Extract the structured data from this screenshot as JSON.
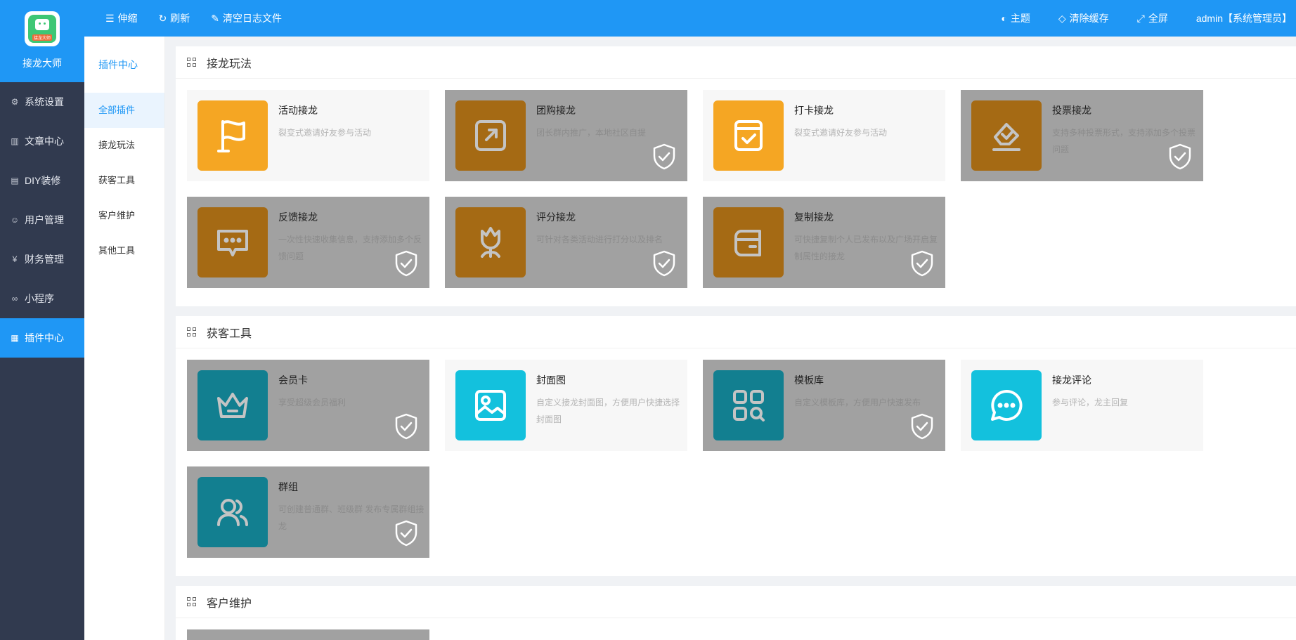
{
  "brand": {
    "logo_tag": "接龙大师",
    "name": "接龙大师"
  },
  "sidebar": {
    "items": [
      {
        "label": "系统设置",
        "icon": "gear-icon"
      },
      {
        "label": "文章中心",
        "icon": "book-icon"
      },
      {
        "label": "DIY装修",
        "icon": "layout-icon"
      },
      {
        "label": "用户管理",
        "icon": "user-icon"
      },
      {
        "label": "财务管理",
        "icon": "yen-icon"
      },
      {
        "label": "小程序",
        "icon": "link-icon"
      },
      {
        "label": "插件中心",
        "icon": "apps-icon"
      }
    ],
    "active": "插件中心"
  },
  "topbar": {
    "collapse": "伸缩",
    "refresh": "刷新",
    "clear_logs": "清空日志文件",
    "theme": "主题",
    "clear_cache": "清除缓存",
    "fullscreen": "全屏",
    "user": "admin【系统管理员】"
  },
  "submenu": {
    "title": "插件中心",
    "items": [
      "全部插件",
      "接龙玩法",
      "获客工具",
      "客户维护",
      "其他工具"
    ],
    "active": "全部插件"
  },
  "sections": [
    {
      "title": "接龙玩法",
      "cards": [
        {
          "name": "活动接龙",
          "desc": "裂变式邀请好友参与活动"
        },
        {
          "name": "团购接龙",
          "desc": "团长群内推广，本地社区自提"
        },
        {
          "name": "打卡接龙",
          "desc": "裂变式邀请好友参与活动"
        },
        {
          "name": "投票接龙",
          "desc": "支持多种投票形式，支持添加多个投票问题"
        },
        {
          "name": "反馈接龙",
          "desc": "一次性快速收集信息，支持添加多个反馈问题"
        },
        {
          "name": "评分接龙",
          "desc": "可针对各类活动进行打分以及排名"
        },
        {
          "name": "复制接龙",
          "desc": "可快捷复制个人已发布以及广场开启复制属性的接龙"
        }
      ]
    },
    {
      "title": "获客工具",
      "cards": [
        {
          "name": "会员卡",
          "desc": "享受超级会员福利"
        },
        {
          "name": "封面图",
          "desc": "自定义接龙封面图，方便用户快捷选择封面图"
        },
        {
          "name": "模板库",
          "desc": "自定义模板库，方便用户快速发布"
        },
        {
          "name": "接龙评论",
          "desc": "参与评论，龙主回复"
        },
        {
          "name": "群组",
          "desc": "可创建普通群、班级群 发布专属群组接龙"
        }
      ]
    },
    {
      "title": "客户维护",
      "cards": []
    }
  ],
  "colors": {
    "primary": "#1f97f5",
    "sidebar": "#313a4f",
    "orange": "#f5a623",
    "cyan": "#13c1dd",
    "disabled": "#a1a1a1"
  }
}
